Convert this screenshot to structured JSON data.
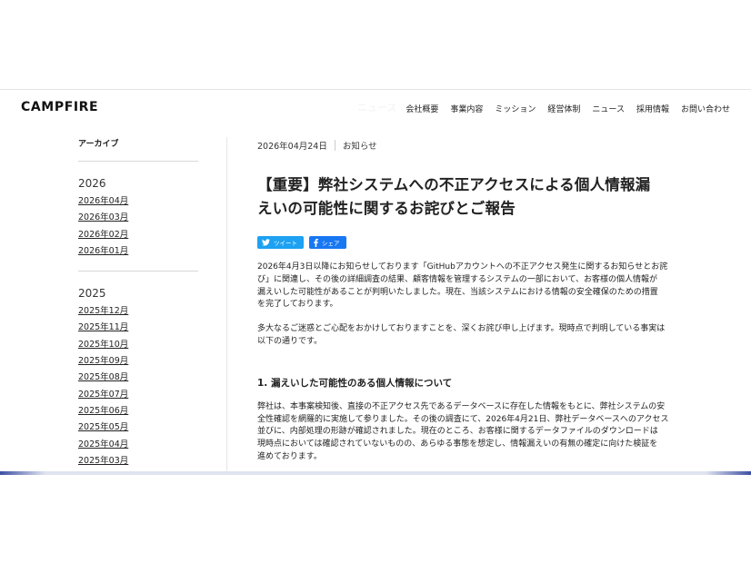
{
  "header": {
    "logo": "CAMPFIRE",
    "ghost_label": "ニュース",
    "nav": [
      "会社概要",
      "事業内容",
      "ミッション",
      "経営体制",
      "ニュース",
      "採用情報",
      "お問い合わせ"
    ]
  },
  "sidebar": {
    "title": "アーカイブ",
    "years": [
      {
        "year": "2026",
        "months": [
          "2026年04月",
          "2026年03月",
          "2026年02月",
          "2026年01月"
        ]
      },
      {
        "year": "2025",
        "months": [
          "2025年12月",
          "2025年11月",
          "2025年10月",
          "2025年09月",
          "2025年08月",
          "2025年07月",
          "2025年06月",
          "2025年05月",
          "2025年04月",
          "2025年03月"
        ]
      }
    ]
  },
  "article": {
    "date": "2026年04月24日",
    "category": "お知らせ",
    "title_line1": "【重要】弊社システムへの不正アクセスによる個人情報漏",
    "title_line2": "えいの可能性に関するお詫びとご報告",
    "share": {
      "tweet": "ツイート",
      "facebook": "シェア"
    },
    "para1_lines": [
      "2026年4月3日以降にお知らせしております「GitHubアカウントへの不正アクセス発生に関するお知らせとお詫",
      "び」に関連し、その後の詳細調査の結果、顧客情報を管理するシステムの一部において、お客様の個人情報が",
      "漏えいした可能性があることが判明いたしました。現在、当該システムにおける情報の安全確保のための措置",
      "を完了しております。"
    ],
    "para2_lines": [
      "多大なるご迷惑とご心配をおかけしておりますことを、深くお詫び申し上げます。現時点で判明している事実は",
      "以下の通りです。"
    ],
    "section1_heading": "1. 漏えいした可能性のある個人情報について",
    "para3_lines": [
      "弊社は、本事案検知後、直接の不正アクセス先であるデータベースに存在した情報をもとに、弊社システムの安",
      "全性確認を網羅的に実施して参りました。その後の調査にて、2026年4月21日、弊社データベースへのアクセス",
      "並びに、内部処理の形跡が確認されました。現在のところ、お客様に関するデータファイルのダウンロードは",
      "現時点においては確認されていないものの、あらゆる事態を想定し、情報漏えいの有無の確定に向けた検証を",
      "進めております。"
    ]
  }
}
